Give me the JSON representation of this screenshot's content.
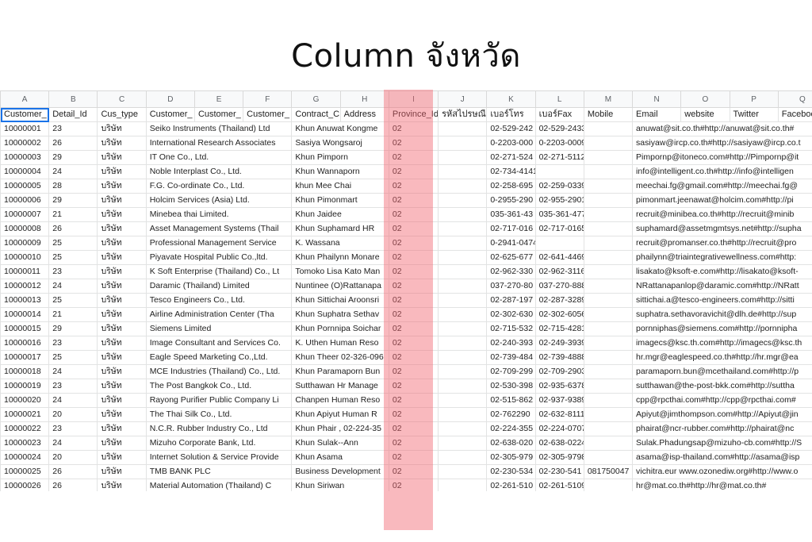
{
  "title": "Column จังหวัด",
  "colors": {
    "highlight": "#f2646e",
    "selection": "#1a73e8"
  },
  "col_letters": [
    "A",
    "B",
    "C",
    "D",
    "E",
    "F",
    "G",
    "H",
    "I",
    "J",
    "K",
    "L",
    "M",
    "N",
    "O",
    "P",
    "Q"
  ],
  "headers": [
    "Customer_",
    "Detail_Id",
    "Cus_type",
    "Customer_",
    "Customer_",
    "Customer_",
    "Contract_C",
    "Address",
    "Province_Id",
    "รหัสไปรษณี",
    "เบอร์โทร",
    "เบอร์Fax",
    "Mobile",
    "Email",
    "website",
    "Twitter",
    "Facebook"
  ],
  "rows": [
    {
      "id": "10000001",
      "detail": "23",
      "type": "บริษัท",
      "name": "Seiko Instruments (Thailand) Ltd",
      "contact": "Khun Anuwat Kongme",
      "prov": "02",
      "tel": "02-529-242",
      "fax": "02-529-2433",
      "mobile": "",
      "email": "anuwat@sit.co.th#http://anuwat@sit.co.th#"
    },
    {
      "id": "10000002",
      "detail": "26",
      "type": "บริษัท",
      "name": "International Research Associates",
      "contact": "Sasiya Wongsaroj",
      "prov": "02",
      "tel": "0-2203-000",
      "fax": "0-2203-0009",
      "mobile": "",
      "email": "sasiyaw@ircp.co.th#http://sasiyaw@ircp.co.t"
    },
    {
      "id": "10000003",
      "detail": "29",
      "type": "บริษัท",
      "name": "IT One Co., Ltd.",
      "contact": "Khun Pimporn",
      "prov": "02",
      "tel": "02-271-524",
      "fax": "02-271-5112",
      "mobile": "",
      "email": "Pimpornp@itoneco.com#http://Pimpornp@it"
    },
    {
      "id": "10000004",
      "detail": "24",
      "type": "บริษัท",
      "name": "Noble Interplast Co., Ltd.",
      "contact": "Khun Wannaporn",
      "prov": "02",
      "tel": "02-734-4141",
      "fax": "",
      "mobile": "",
      "email": "info@intelligent.co.th#http://info@intelligen"
    },
    {
      "id": "10000005",
      "detail": "28",
      "type": "บริษัท",
      "name": "F.G. Co-ordinate Co., Ltd.",
      "contact": "khun  Mee Chai",
      "prov": "02",
      "tel": "02-258-695",
      "fax": "02-259-0339",
      "mobile": "",
      "email": "meechai.fg@gmail.com#http://meechai.fg@"
    },
    {
      "id": "10000006",
      "detail": "29",
      "type": "บริษัท",
      "name": "Holcim Services (Asia) Ltd.",
      "contact": "Khun Pimonmart",
      "prov": "02",
      "tel": "0-2955-290",
      "fax": "02-955-2901",
      "mobile": "",
      "email": "pimonmart.jeenawat@holcim.com#http://pi"
    },
    {
      "id": "10000007",
      "detail": "21",
      "type": "บริษัท",
      "name": "Minebea thai Limited.",
      "contact": "Khun Jaidee",
      "prov": "02",
      "tel": "035-361-43",
      "fax": "035-361-477",
      "mobile": "",
      "email": "recruit@minibea.co.th#http://recruit@minib"
    },
    {
      "id": "10000008",
      "detail": "26",
      "type": "บริษัท",
      "name": "Asset Management Systems (Thail",
      "contact": "Khun Suphamard   HR",
      "prov": "02",
      "tel": "02-717-016",
      "fax": "02-717-0165#121",
      "mobile": "",
      "email": "suphamard@assetmgmtsys.net#http://supha"
    },
    {
      "id": "10000009",
      "detail": "25",
      "type": "บริษัท",
      "name": "Professional Management Service",
      "contact": "K. Wassana",
      "prov": "02",
      "tel": "0-2941-0474",
      "fax": "",
      "mobile": "",
      "email": "recruit@promanser.co.th#http://recruit@pro"
    },
    {
      "id": "10000010",
      "detail": "25",
      "type": "บริษัท",
      "name": "Piyavate Hospital Public Co.,ltd.",
      "contact": "Khun Phailynn Monare",
      "prov": "02",
      "tel": "02-625-677",
      "fax": "02-641-4469",
      "mobile": "",
      "email": "phailynn@triaintegrativewellness.com#http:"
    },
    {
      "id": "10000011",
      "detail": "23",
      "type": "บริษัท",
      "name": "K Soft Enterprise (Thailand) Co., Lt",
      "contact": "Tomoko Lisa Kato  Man",
      "prov": "02",
      "tel": "02-962-330",
      "fax": "02-962-3116",
      "mobile": "",
      "email": "lisakato@ksoft-e.com#http://lisakato@ksoft-"
    },
    {
      "id": "10000012",
      "detail": "24",
      "type": "บริษัท",
      "name": "Daramic (Thailand) Limited",
      "contact": "Nuntinee (O)Rattanapa",
      "prov": "02",
      "tel": "037-270-80",
      "fax": "037-270-888",
      "mobile": "",
      "email": "NRattanapanlop@daramic.com#http://NRatt"
    },
    {
      "id": "10000013",
      "detail": "25",
      "type": "บริษัท",
      "name": "Tesco Engineers Co., Ltd.",
      "contact": "Khun Sittichai Aroonsri",
      "prov": "02",
      "tel": "02-287-197",
      "fax": "02-287-3289",
      "mobile": "",
      "email": "sittichai.a@tesco-engineers.com#http://sitti"
    },
    {
      "id": "10000014",
      "detail": "21",
      "type": "บริษัท",
      "name": "Airline Administration Center (Tha",
      "contact": "Khun Suphatra Sethav",
      "prov": "02",
      "tel": "02-302-630",
      "fax": "02-302-6056",
      "mobile": "",
      "email": "suphatra.sethavoravichit@dlh.de#http://sup"
    },
    {
      "id": "10000015",
      "detail": "29",
      "type": "บริษัท",
      "name": "Siemens Limited",
      "contact": "Khun Pornnipa Soichar",
      "prov": "02",
      "tel": "02-715-532",
      "fax": "02-715-4281",
      "mobile": "",
      "email": "pornniphas@siemens.com#http://pornnipha"
    },
    {
      "id": "10000016",
      "detail": "23",
      "type": "บริษัท",
      "name": "Image Consultant and Services Co.",
      "contact": "K. Uthen  Human Reso",
      "prov": "02",
      "tel": "02-240-393",
      "fax": "02-249-3939#114",
      "mobile": "",
      "email": "imagecs@ksc.th.com#http://imagecs@ksc.th"
    },
    {
      "id": "10000017",
      "detail": "25",
      "type": "บริษัท",
      "name": "Eagle Speed Marketing Co.,Ltd.",
      "contact": "Khun Theer 02-326-096",
      "prov": "02",
      "tel": "02-739-484",
      "fax": "02-739-4888",
      "mobile": "",
      "email": "hr.mgr@eaglespeed.co.th#http://hr.mgr@ea"
    },
    {
      "id": "10000018",
      "detail": "24",
      "type": "บริษัท",
      "name": "MCE Industries (Thailand) Co., Ltd.",
      "contact": "Khun Paramaporn Bun",
      "prov": "02",
      "tel": "02-709-299",
      "fax": "02-709-2903",
      "mobile": "",
      "email": "paramaporn.bun@mcethailand.com#http://p"
    },
    {
      "id": "10000019",
      "detail": "23",
      "type": "บริษัท",
      "name": "The Post Bangkok Co., Ltd.",
      "contact": "Sutthawan  Hr Manage",
      "prov": "02",
      "tel": "02-530-398",
      "fax": "02-935-6378",
      "mobile": "",
      "email": "sutthawan@the-post-bkk.com#http://suttha"
    },
    {
      "id": "10000020",
      "detail": "24",
      "type": "บริษัท",
      "name": "Rayong Purifier Public Company Li",
      "contact": "Chanpen  Human Reso",
      "prov": "02",
      "tel": "02-515-862",
      "fax": "02-937-9389",
      "mobile": "",
      "email": "cpp@rpcthai.com#http://cpp@rpcthai.com#"
    },
    {
      "id": "10000021",
      "detail": "20",
      "type": "บริษัท",
      "name": "The Thai Silk Co., Ltd.",
      "contact": "Khun  Apiyut  Human R",
      "prov": "02",
      "tel": "02-762290",
      "fax": "02-632-8111",
      "mobile": "",
      "email": "Apiyut@jimthompson.com#http://Apiyut@jin"
    },
    {
      "id": "10000022",
      "detail": "23",
      "type": "บริษัท",
      "name": "N.C.R. Rubber Industry Co., Ltd",
      "contact": "Khun Phair , 02-224-35",
      "prov": "02",
      "tel": "02-224-355",
      "fax": "02-224-0707",
      "mobile": "",
      "email": "phairat@ncr-rubber.com#http://phairat@nc"
    },
    {
      "id": "10000023",
      "detail": "24",
      "type": "บริษัท",
      "name": "Mizuho Corporate Bank, Ltd.",
      "contact": "Khun Sulak--Ann",
      "prov": "02",
      "tel": "02-638-020",
      "fax": "02-638-0224",
      "mobile": "",
      "email": "Sulak.Phadungsap@mizuho-cb.com#http://S"
    },
    {
      "id": "10000024",
      "detail": "20",
      "type": "บริษัท",
      "name": "Internet Solution & Service Provide",
      "contact": "Khun Asama",
      "prov": "02",
      "tel": "02-305-979",
      "fax": "02-305-9798",
      "mobile": "",
      "email": "asama@isp-thailand.com#http://asama@isp"
    },
    {
      "id": "10000025",
      "detail": "26",
      "type": "บริษัท",
      "name": "TMB BANK PLC",
      "contact": "Business Development",
      "prov": "02",
      "tel": "02-230-534",
      "fax": "02-230-541",
      "mobile": "081750047",
      "email": "vichitra.eur www.ozonediw.org#http://www.o"
    },
    {
      "id": "10000026",
      "detail": "26",
      "type": "บริษัท",
      "name": "Material  Automation (Thailand) C",
      "contact": "Khun Siriwan",
      "prov": "02",
      "tel": "02-261-510",
      "fax": "02-261-5109",
      "mobile": "",
      "email": "hr@mat.co.th#http://hr@mat.co.th#"
    }
  ]
}
